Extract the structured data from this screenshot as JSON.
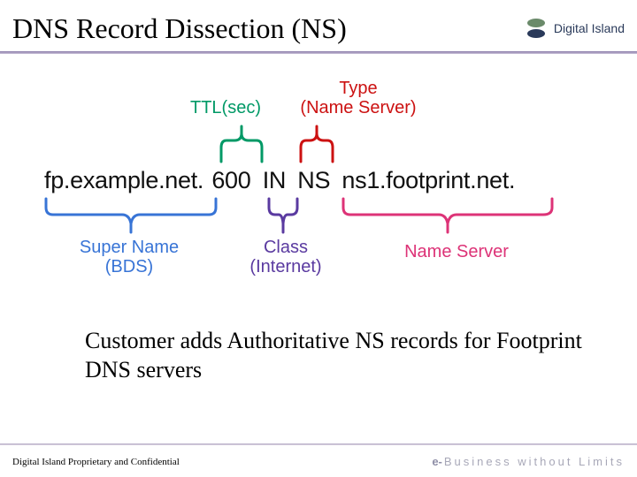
{
  "header": {
    "title": "DNS Record Dissection (NS)",
    "brand": "Digital Island"
  },
  "annotations": {
    "ttl": "TTL(sec)",
    "type_line1": "Type",
    "type_line2": "(Name Server)",
    "super_line1": "Super Name",
    "super_line2": "(BDS)",
    "class_line1": "Class",
    "class_line2": "(Internet)",
    "ns": "Name Server"
  },
  "record": {
    "super_name": "fp.example.net.",
    "ttl": "600",
    "class": "IN",
    "type": "NS",
    "name_server": "ns1.footprint.net."
  },
  "body": "Customer adds Authoritative NS records for Footprint DNS servers",
  "footer": {
    "left": "Digital Island Proprietary and Confidential",
    "right_prefix": "e-",
    "right_rest": "Business without Limits"
  },
  "colors": {
    "green": "#009966",
    "red": "#cc1111",
    "blue": "#3874d6",
    "purple": "#5a3aa0",
    "pink": "#dd3377"
  }
}
